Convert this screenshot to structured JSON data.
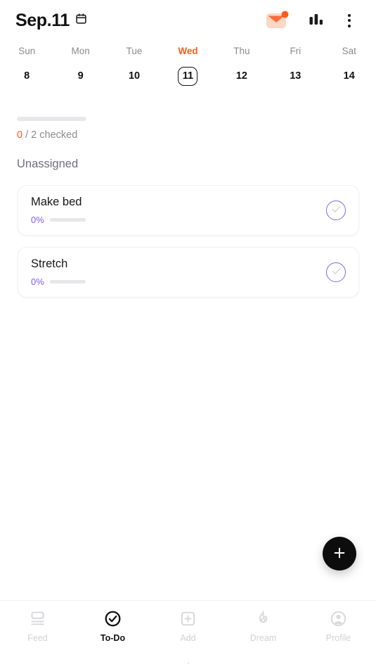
{
  "header": {
    "title": "Sep.11",
    "calendar_icon": "calendar-icon",
    "mail_icon": "mail-icon",
    "stats_icon": "bar-chart-icon",
    "more_icon": "more-vertical-icon"
  },
  "week": {
    "days": [
      {
        "name": "Sun",
        "number": "8",
        "active": false
      },
      {
        "name": "Mon",
        "number": "9",
        "active": false
      },
      {
        "name": "Tue",
        "number": "10",
        "active": false
      },
      {
        "name": "Wed",
        "number": "11",
        "active": true
      },
      {
        "name": "Thu",
        "number": "12",
        "active": false
      },
      {
        "name": "Fri",
        "number": "13",
        "active": false
      },
      {
        "name": "Sat",
        "number": "14",
        "active": false
      }
    ]
  },
  "summary": {
    "checked_count": "0",
    "rest_text": "/ 2 checked",
    "progress_percent": 0
  },
  "section": {
    "title": "Unassigned"
  },
  "tasks": [
    {
      "title": "Make bed",
      "percent": "0%"
    },
    {
      "title": "Stretch",
      "percent": "0%"
    }
  ],
  "fab": {
    "label": "add-task",
    "icon": "plus-icon"
  },
  "bottom_nav": {
    "items": [
      {
        "label": "Feed",
        "icon": "feed-icon",
        "active": false
      },
      {
        "label": "To-Do",
        "icon": "check-circle-icon",
        "active": true
      },
      {
        "label": "Add",
        "icon": "plus-square-icon",
        "active": false
      },
      {
        "label": "Dream",
        "icon": "flame-icon",
        "active": false
      },
      {
        "label": "Profile",
        "icon": "user-circle-icon",
        "active": false
      }
    ]
  },
  "colors": {
    "accent_orange": "#FF5A1F",
    "accent_purple": "#7C5CFC",
    "text_primary": "#111111",
    "text_muted": "#8B8B92"
  }
}
